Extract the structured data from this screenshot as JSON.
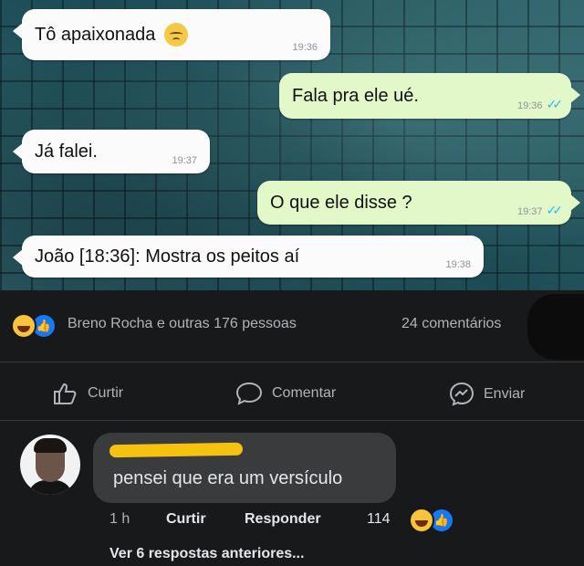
{
  "chat": {
    "messages": [
      {
        "text": "Tô apaixonada",
        "time": "19:36",
        "emoji": "sad-face-emoji"
      },
      {
        "text": "Fala pra ele ué.",
        "time": "19:36",
        "checks": "✓✓"
      },
      {
        "text": "Já falei.",
        "time": "19:37"
      },
      {
        "text": "O que ele disse ?",
        "time": "19:37",
        "checks": "✓✓"
      },
      {
        "text": "João [18:36]: Mostra os peitos aí",
        "time": "19:38"
      }
    ]
  },
  "post": {
    "reactions": "Breno Rocha e outras 176 pessoas",
    "comments_count": "24 comentários",
    "actions": {
      "like": "Curtir",
      "comment": "Comentar",
      "send": "Enviar"
    }
  },
  "comment": {
    "text": "pensei que era um versículo",
    "time": "1 h",
    "like": "Curtir",
    "reply": "Responder",
    "reaction_count": "114",
    "more_replies": "Ver 6 respostas anteriores..."
  },
  "colors": {
    "background": "#18191a",
    "incoming_bubble": "#fbfbfb",
    "outgoing_bubble": "#e3f8c8",
    "read_ticks": "#34b7f1",
    "comment_box": "#3a3b3c",
    "name_redaction": "#f5c20f"
  }
}
